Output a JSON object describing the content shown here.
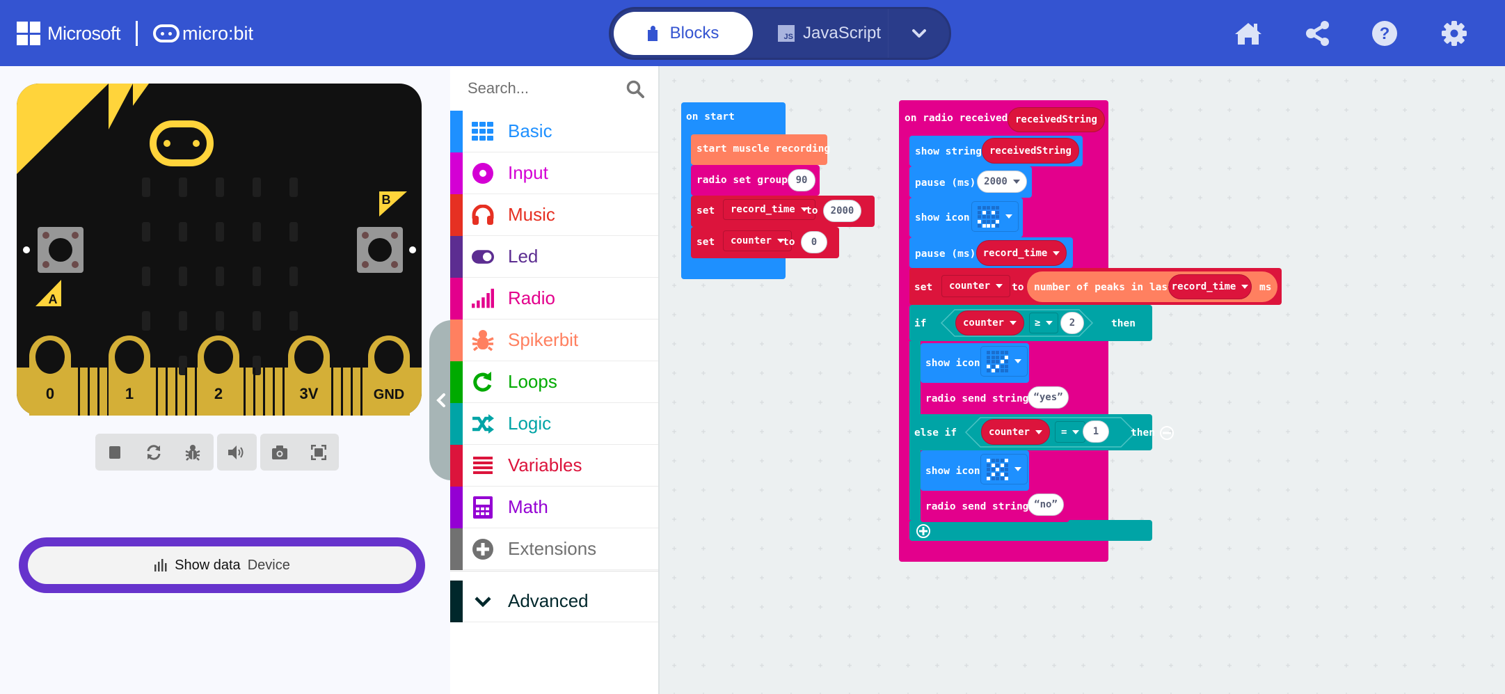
{
  "header": {
    "brand": "Microsoft",
    "product": "micro:bit",
    "modes": [
      {
        "label": "Blocks",
        "active": true
      },
      {
        "label": "JavaScript",
        "active": false
      }
    ],
    "js_badge": "JS",
    "actions": [
      "home-icon",
      "share-icon",
      "help-icon",
      "settings-icon"
    ],
    "color": "#3454D1"
  },
  "simulator": {
    "pins": [
      "0",
      "1",
      "2",
      "3V",
      "GND"
    ],
    "buttons": [
      "A",
      "B"
    ],
    "toolbar": [
      "stop-icon",
      "restart-icon",
      "debug-icon",
      "sound-icon",
      "screenshot-icon",
      "fullscreen-icon"
    ],
    "show_data": {
      "label": "Show data",
      "sub": "Device"
    }
  },
  "toolbox": {
    "search_placeholder": "Search...",
    "categories": [
      {
        "label": "Basic",
        "color": "#1E90FF",
        "icon": "grid-icon"
      },
      {
        "label": "Input",
        "color": "#D400D4",
        "icon": "input-icon"
      },
      {
        "label": "Music",
        "color": "#E63022",
        "icon": "headphones-icon"
      },
      {
        "label": "Led",
        "color": "#5C2D91",
        "icon": "toggle-icon"
      },
      {
        "label": "Radio",
        "color": "#E3008C",
        "icon": "signal-icon"
      },
      {
        "label": "Spikerbit",
        "color": "#FF8060",
        "icon": "bug-icon"
      },
      {
        "label": "Loops",
        "color": "#00AA00",
        "icon": "loop-icon"
      },
      {
        "label": "Logic",
        "color": "#00A4A6",
        "icon": "shuffle-icon"
      },
      {
        "label": "Variables",
        "color": "#DC143C",
        "icon": "list-icon"
      },
      {
        "label": "Math",
        "color": "#9400D3",
        "icon": "calculator-icon"
      },
      {
        "label": "Extensions",
        "color": "#717171",
        "icon": "plus-circle-icon"
      }
    ],
    "advanced": {
      "label": "Advanced",
      "color": "#00272B"
    }
  },
  "workspace": {
    "on_start": {
      "title": "on start",
      "start_muscle": "start muscle recording",
      "radio_set_group": "radio set group",
      "group_value": "90",
      "set1": {
        "kw": "set",
        "var": "record_time",
        "to": "to",
        "value": "2000"
      },
      "set2": {
        "kw": "set",
        "var": "counter",
        "to": "to",
        "value": "0"
      }
    },
    "on_radio": {
      "title": "on radio received",
      "param": "receivedString",
      "show_string": "show string",
      "show_string_arg": "receivedString",
      "pause1": "pause (ms)",
      "pause1_value": "2000",
      "show_icon1": "show icon",
      "icon1": [
        [
          0,
          0,
          0,
          0,
          0
        ],
        [
          0,
          1,
          0,
          1,
          0
        ],
        [
          0,
          0,
          0,
          0,
          0
        ],
        [
          1,
          0,
          0,
          0,
          1
        ],
        [
          0,
          1,
          1,
          1,
          0
        ]
      ],
      "pause2": "pause (ms)",
      "pause2_value": "record_time",
      "set_kw": "set",
      "set_var": "counter",
      "set_to": "to",
      "peaks_label": "number of peaks in last",
      "peaks_var": "record_time",
      "peaks_unit": "ms",
      "if_kw": "if",
      "if_var": "counter",
      "if_op": "≥",
      "if_value": "2",
      "then_kw": "then",
      "show_icon2": "show icon",
      "icon2": [
        [
          0,
          0,
          0,
          0,
          0
        ],
        [
          0,
          0,
          0,
          0,
          1
        ],
        [
          0,
          0,
          0,
          1,
          0
        ],
        [
          1,
          0,
          1,
          0,
          0
        ],
        [
          0,
          1,
          0,
          0,
          0
        ]
      ],
      "send1": "radio send string",
      "send1_value": "yes",
      "elseif_kw": "else if",
      "elseif_var": "counter",
      "elseif_op": "=",
      "elseif_value": "1",
      "elseif_then": "then",
      "show_icon3": "show icon",
      "icon3": [
        [
          1,
          0,
          0,
          0,
          1
        ],
        [
          0,
          1,
          0,
          1,
          0
        ],
        [
          0,
          0,
          1,
          0,
          0
        ],
        [
          0,
          1,
          0,
          1,
          0
        ],
        [
          1,
          0,
          0,
          0,
          1
        ]
      ],
      "send2": "radio send string",
      "send2_value": "no"
    }
  }
}
